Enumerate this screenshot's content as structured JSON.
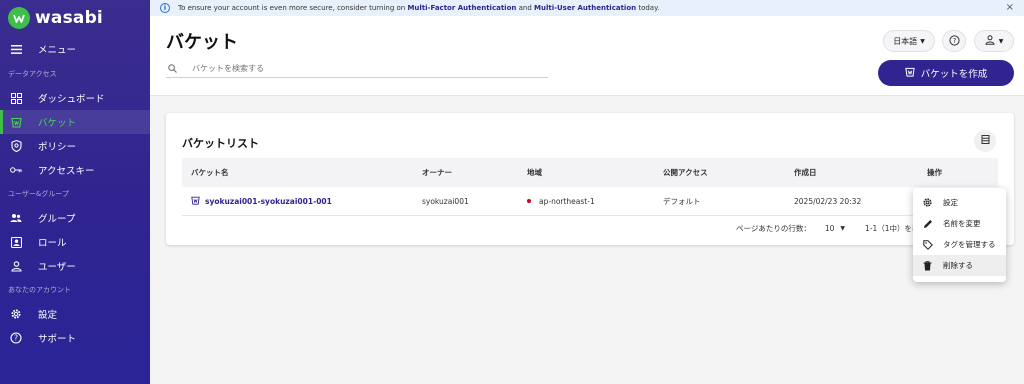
{
  "brand": {
    "name": "wasabi",
    "accent": "#2f2490",
    "green": "#3fbf4a"
  },
  "banner": {
    "text_before": "To ensure your account is even more secure, consider turning on ",
    "mfa": "Multi-Factor Authentication",
    "text_mid": " and ",
    "mua": "Multi-User Authentication",
    "text_after": " today."
  },
  "sidebar": {
    "menu_label": "メニュー",
    "section_data": "データアクセス",
    "section_users": "ユーザー&グループ",
    "section_account": "あなたのアカウント",
    "items": [
      {
        "label": "ダッシュボード",
        "icon": "dashboard-icon"
      },
      {
        "label": "バケット",
        "icon": "bucket-icon"
      },
      {
        "label": "ポリシー",
        "icon": "policy-icon"
      },
      {
        "label": "アクセスキー",
        "icon": "key-icon"
      },
      {
        "label": "グループ",
        "icon": "group-icon"
      },
      {
        "label": "ロール",
        "icon": "role-icon"
      },
      {
        "label": "ユーザー",
        "icon": "user-icon"
      },
      {
        "label": "設定",
        "icon": "gear-icon"
      },
      {
        "label": "サポート",
        "icon": "help-icon"
      }
    ]
  },
  "header": {
    "title": "バケット",
    "search_placeholder": "バケットを検索する",
    "language": "日本語",
    "create_label": "バケットを作成"
  },
  "card": {
    "title": "バケットリスト",
    "columns": [
      "バケット名",
      "オーナー",
      "地域",
      "公開アクセス",
      "作成日",
      "操作"
    ],
    "rows": [
      {
        "name": "syokuzai001-syokuzai001-001",
        "owner": "syokuzai001",
        "region": "ap-northeast-1",
        "access": "デフォルト",
        "created": "2025/02/23 20:32"
      }
    ],
    "pager": {
      "rows_label": "ページあたりの行数：",
      "rows_value": "10",
      "range": "1-1（1中）を表"
    }
  },
  "dropdown": {
    "items": [
      {
        "label": "設定",
        "icon": "gear-icon"
      },
      {
        "label": "名前を変更",
        "icon": "pencil-icon"
      },
      {
        "label": "タグを管理する",
        "icon": "tag-icon"
      },
      {
        "label": "削除する",
        "icon": "trash-icon"
      }
    ]
  }
}
